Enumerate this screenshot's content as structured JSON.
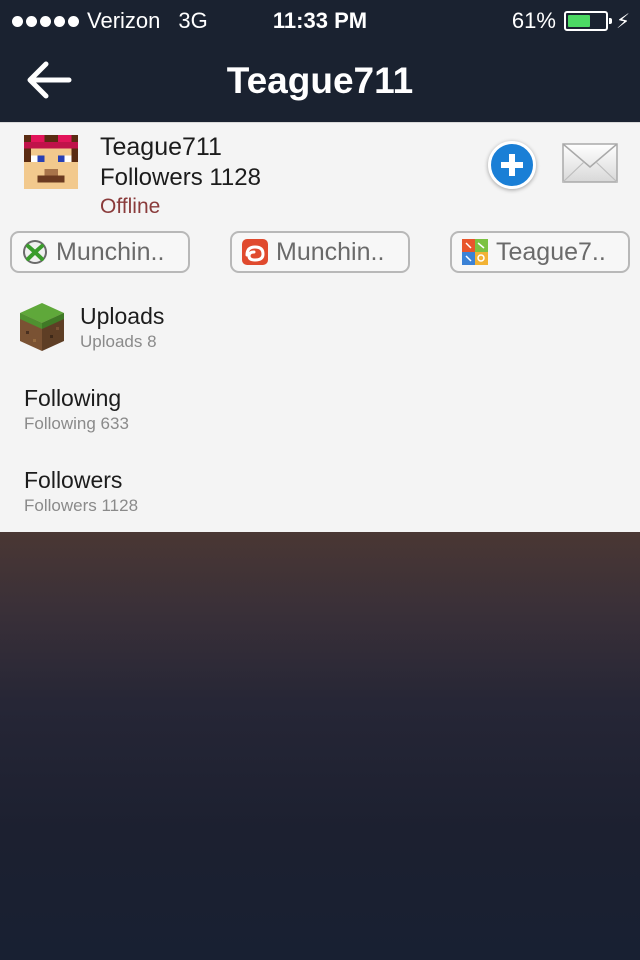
{
  "status_bar": {
    "carrier": "Verizon",
    "network": "3G",
    "time": "11:33 PM",
    "battery_percent_label": "61%",
    "battery_level": 0.61,
    "signal_dots": 5
  },
  "nav": {
    "title": "Teague711",
    "back_icon": "back-arrow-icon"
  },
  "profile": {
    "name": "Teague711",
    "followers_line": "Followers 1128",
    "status": "Offline",
    "status_color": "#8a3b3b",
    "follow_icon": "add-circle-icon",
    "message_icon": "envelope-icon"
  },
  "accounts": [
    {
      "icon": "xbox-icon",
      "label": "Munchin.."
    },
    {
      "icon": "game-center-icon",
      "label": "Munchin.."
    },
    {
      "icon": "gamecenter-apps-icon",
      "label": "Teague7.."
    }
  ],
  "rows": [
    {
      "title": "Uploads",
      "subtitle": "Uploads 8",
      "icon": "grass-block-icon"
    },
    {
      "title": "Following",
      "subtitle": "Following 633"
    },
    {
      "title": "Followers",
      "subtitle": "Followers 1128"
    }
  ],
  "colors": {
    "header_bg": "#1a2230",
    "accent_blue": "#1a7fd6",
    "battery_green": "#4cd964"
  }
}
